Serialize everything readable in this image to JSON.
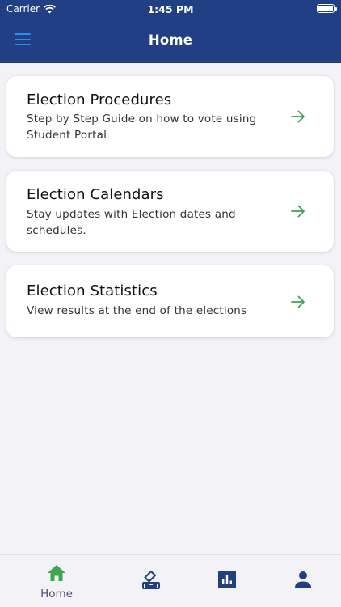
{
  "status_bar": {
    "carrier": "Carrier",
    "time": "1:45 PM"
  },
  "nav": {
    "title": "Home"
  },
  "cards": [
    {
      "title": "Election Procedures",
      "description": "Step by Step Guide on how to vote using Student Portal"
    },
    {
      "title": "Election Calendars",
      "description": "Stay updates with Election dates and schedules."
    },
    {
      "title": "Election Statistics",
      "description": "View results at the end of the elections"
    }
  ],
  "tabs": [
    {
      "label": "Home",
      "icon": "home-icon",
      "active": true
    },
    {
      "label": "",
      "icon": "vote-icon",
      "active": false
    },
    {
      "label": "",
      "icon": "bar-chart-icon",
      "active": false
    },
    {
      "label": "",
      "icon": "person-icon",
      "active": false
    }
  ],
  "colors": {
    "header": "#213f85",
    "accent_green": "#3aa84b",
    "menu_blue": "#2f8df0",
    "tab_icon": "#223f7f"
  }
}
